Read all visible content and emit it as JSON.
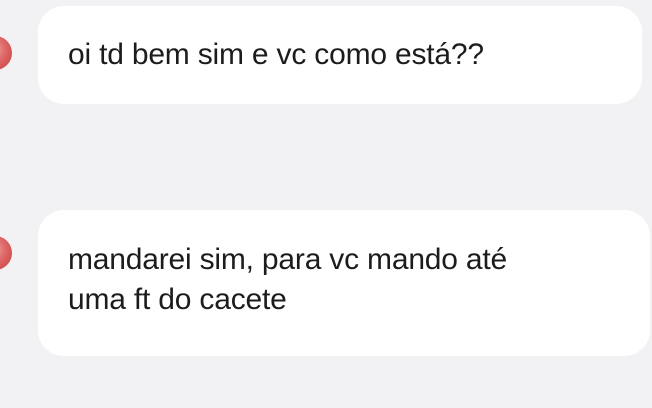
{
  "messages": [
    {
      "sender": "contact",
      "text": "oi td bem sim e vc como está??"
    },
    {
      "sender": "contact",
      "lines": [
        "mandarei sim, para vc mando até",
        "uma ft do cacete"
      ]
    }
  ],
  "colors": {
    "background": "#f2f2f4",
    "bubble": "#ffffff",
    "text": "#1c1c1c",
    "avatar": "#d94f4f"
  }
}
